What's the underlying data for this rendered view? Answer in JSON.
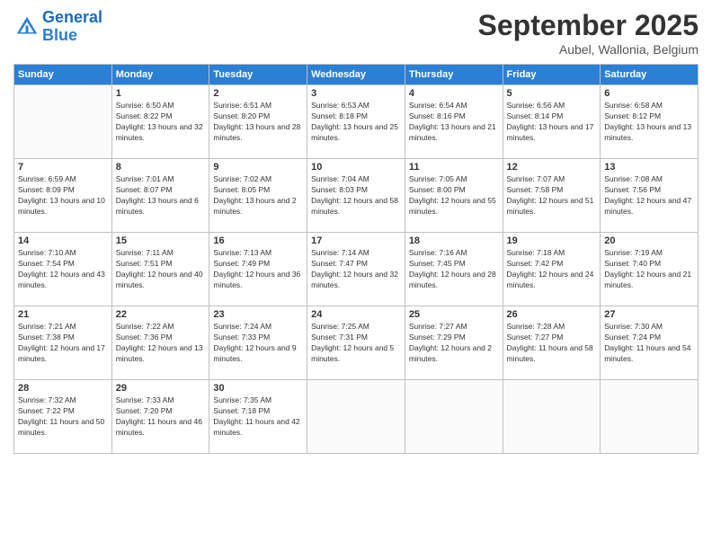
{
  "logo": {
    "line1": "General",
    "line2": "Blue"
  },
  "title": "September 2025",
  "location": "Aubel, Wallonia, Belgium",
  "weekdays": [
    "Sunday",
    "Monday",
    "Tuesday",
    "Wednesday",
    "Thursday",
    "Friday",
    "Saturday"
  ],
  "weeks": [
    [
      {
        "day": "",
        "sunrise": "",
        "sunset": "",
        "daylight": ""
      },
      {
        "day": "1",
        "sunrise": "Sunrise: 6:50 AM",
        "sunset": "Sunset: 8:22 PM",
        "daylight": "Daylight: 13 hours and 32 minutes."
      },
      {
        "day": "2",
        "sunrise": "Sunrise: 6:51 AM",
        "sunset": "Sunset: 8:20 PM",
        "daylight": "Daylight: 13 hours and 28 minutes."
      },
      {
        "day": "3",
        "sunrise": "Sunrise: 6:53 AM",
        "sunset": "Sunset: 8:18 PM",
        "daylight": "Daylight: 13 hours and 25 minutes."
      },
      {
        "day": "4",
        "sunrise": "Sunrise: 6:54 AM",
        "sunset": "Sunset: 8:16 PM",
        "daylight": "Daylight: 13 hours and 21 minutes."
      },
      {
        "day": "5",
        "sunrise": "Sunrise: 6:56 AM",
        "sunset": "Sunset: 8:14 PM",
        "daylight": "Daylight: 13 hours and 17 minutes."
      },
      {
        "day": "6",
        "sunrise": "Sunrise: 6:58 AM",
        "sunset": "Sunset: 8:12 PM",
        "daylight": "Daylight: 13 hours and 13 minutes."
      }
    ],
    [
      {
        "day": "7",
        "sunrise": "Sunrise: 6:59 AM",
        "sunset": "Sunset: 8:09 PM",
        "daylight": "Daylight: 13 hours and 10 minutes."
      },
      {
        "day": "8",
        "sunrise": "Sunrise: 7:01 AM",
        "sunset": "Sunset: 8:07 PM",
        "daylight": "Daylight: 13 hours and 6 minutes."
      },
      {
        "day": "9",
        "sunrise": "Sunrise: 7:02 AM",
        "sunset": "Sunset: 8:05 PM",
        "daylight": "Daylight: 13 hours and 2 minutes."
      },
      {
        "day": "10",
        "sunrise": "Sunrise: 7:04 AM",
        "sunset": "Sunset: 8:03 PM",
        "daylight": "Daylight: 12 hours and 58 minutes."
      },
      {
        "day": "11",
        "sunrise": "Sunrise: 7:05 AM",
        "sunset": "Sunset: 8:00 PM",
        "daylight": "Daylight: 12 hours and 55 minutes."
      },
      {
        "day": "12",
        "sunrise": "Sunrise: 7:07 AM",
        "sunset": "Sunset: 7:58 PM",
        "daylight": "Daylight: 12 hours and 51 minutes."
      },
      {
        "day": "13",
        "sunrise": "Sunrise: 7:08 AM",
        "sunset": "Sunset: 7:56 PM",
        "daylight": "Daylight: 12 hours and 47 minutes."
      }
    ],
    [
      {
        "day": "14",
        "sunrise": "Sunrise: 7:10 AM",
        "sunset": "Sunset: 7:54 PM",
        "daylight": "Daylight: 12 hours and 43 minutes."
      },
      {
        "day": "15",
        "sunrise": "Sunrise: 7:11 AM",
        "sunset": "Sunset: 7:51 PM",
        "daylight": "Daylight: 12 hours and 40 minutes."
      },
      {
        "day": "16",
        "sunrise": "Sunrise: 7:13 AM",
        "sunset": "Sunset: 7:49 PM",
        "daylight": "Daylight: 12 hours and 36 minutes."
      },
      {
        "day": "17",
        "sunrise": "Sunrise: 7:14 AM",
        "sunset": "Sunset: 7:47 PM",
        "daylight": "Daylight: 12 hours and 32 minutes."
      },
      {
        "day": "18",
        "sunrise": "Sunrise: 7:16 AM",
        "sunset": "Sunset: 7:45 PM",
        "daylight": "Daylight: 12 hours and 28 minutes."
      },
      {
        "day": "19",
        "sunrise": "Sunrise: 7:18 AM",
        "sunset": "Sunset: 7:42 PM",
        "daylight": "Daylight: 12 hours and 24 minutes."
      },
      {
        "day": "20",
        "sunrise": "Sunrise: 7:19 AM",
        "sunset": "Sunset: 7:40 PM",
        "daylight": "Daylight: 12 hours and 21 minutes."
      }
    ],
    [
      {
        "day": "21",
        "sunrise": "Sunrise: 7:21 AM",
        "sunset": "Sunset: 7:38 PM",
        "daylight": "Daylight: 12 hours and 17 minutes."
      },
      {
        "day": "22",
        "sunrise": "Sunrise: 7:22 AM",
        "sunset": "Sunset: 7:36 PM",
        "daylight": "Daylight: 12 hours and 13 minutes."
      },
      {
        "day": "23",
        "sunrise": "Sunrise: 7:24 AM",
        "sunset": "Sunset: 7:33 PM",
        "daylight": "Daylight: 12 hours and 9 minutes."
      },
      {
        "day": "24",
        "sunrise": "Sunrise: 7:25 AM",
        "sunset": "Sunset: 7:31 PM",
        "daylight": "Daylight: 12 hours and 5 minutes."
      },
      {
        "day": "25",
        "sunrise": "Sunrise: 7:27 AM",
        "sunset": "Sunset: 7:29 PM",
        "daylight": "Daylight: 12 hours and 2 minutes."
      },
      {
        "day": "26",
        "sunrise": "Sunrise: 7:28 AM",
        "sunset": "Sunset: 7:27 PM",
        "daylight": "Daylight: 11 hours and 58 minutes."
      },
      {
        "day": "27",
        "sunrise": "Sunrise: 7:30 AM",
        "sunset": "Sunset: 7:24 PM",
        "daylight": "Daylight: 11 hours and 54 minutes."
      }
    ],
    [
      {
        "day": "28",
        "sunrise": "Sunrise: 7:32 AM",
        "sunset": "Sunset: 7:22 PM",
        "daylight": "Daylight: 11 hours and 50 minutes."
      },
      {
        "day": "29",
        "sunrise": "Sunrise: 7:33 AM",
        "sunset": "Sunset: 7:20 PM",
        "daylight": "Daylight: 11 hours and 46 minutes."
      },
      {
        "day": "30",
        "sunrise": "Sunrise: 7:35 AM",
        "sunset": "Sunset: 7:18 PM",
        "daylight": "Daylight: 11 hours and 42 minutes."
      },
      {
        "day": "",
        "sunrise": "",
        "sunset": "",
        "daylight": ""
      },
      {
        "day": "",
        "sunrise": "",
        "sunset": "",
        "daylight": ""
      },
      {
        "day": "",
        "sunrise": "",
        "sunset": "",
        "daylight": ""
      },
      {
        "day": "",
        "sunrise": "",
        "sunset": "",
        "daylight": ""
      }
    ]
  ]
}
